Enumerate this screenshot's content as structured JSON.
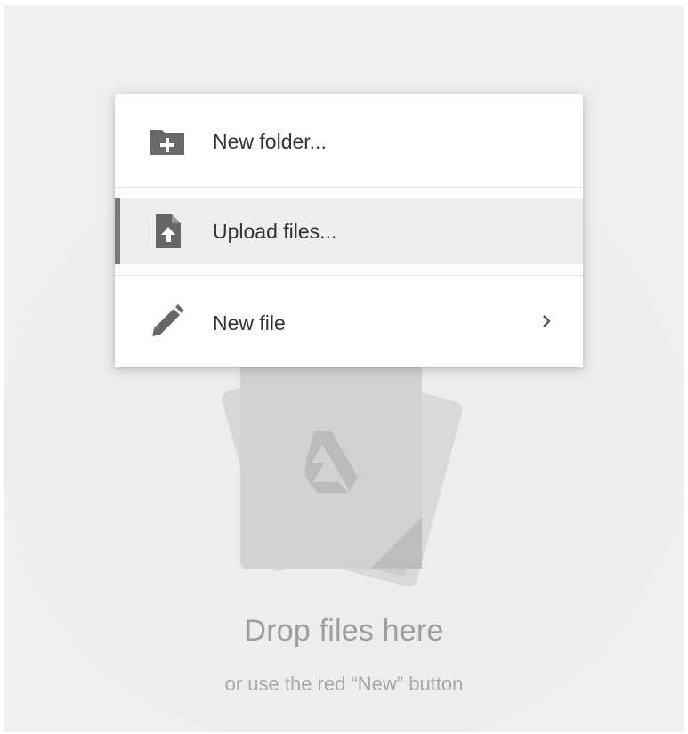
{
  "menu": {
    "items": [
      {
        "label": "New folder...",
        "icon": "folder-plus-icon"
      },
      {
        "label": "Upload files...",
        "icon": "file-upload-icon",
        "selected": true
      },
      {
        "label": "New file",
        "icon": "pencil-icon",
        "has_submenu": true
      }
    ]
  },
  "drop_zone": {
    "title": "Drop files here",
    "subtitle": "or use the red “New” button",
    "icon": "google-drive-icon"
  },
  "colors": {
    "background": "#efefef",
    "menu_background": "#ffffff",
    "selected_row": "#eeeeee",
    "selected_accent": "#777777",
    "icon": "#666666",
    "label_text": "#333333",
    "drop_text": "#9e9e9e"
  }
}
